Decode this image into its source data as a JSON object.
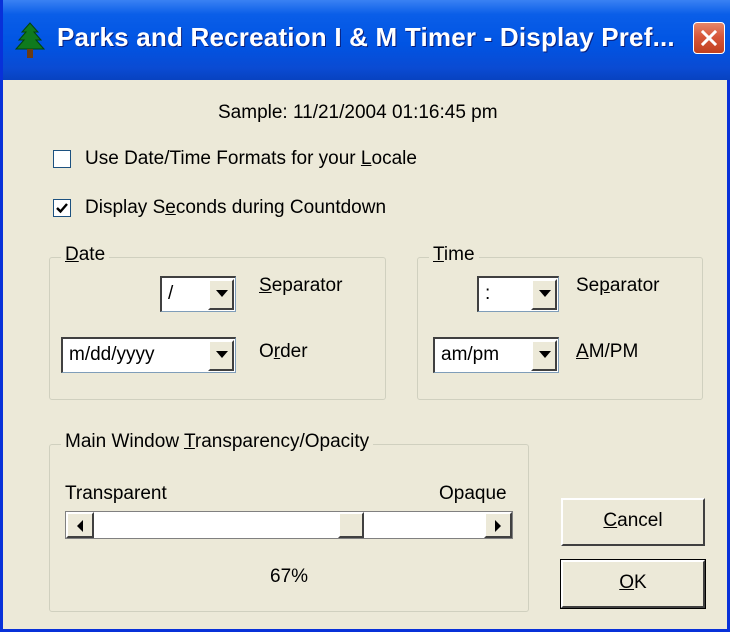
{
  "window": {
    "title": "Parks and Recreation I & M Timer - Display Pref...",
    "app_icon": "tree-icon",
    "close_icon": "close-icon"
  },
  "sample": {
    "text": "Sample: 11/21/2004 01:16:45 pm"
  },
  "options": {
    "use_locale": {
      "label_pre": "Use Date/Time Formats for your ",
      "label_key": "L",
      "label_post": "ocale",
      "checked": false
    },
    "display_seconds": {
      "label_pre": "Display S",
      "label_key": "e",
      "label_post": "conds during Countdown",
      "checked": true
    }
  },
  "date_group": {
    "label_key": "D",
    "label_post": "ate",
    "separator_value": "/",
    "separator_label_key": "S",
    "separator_label_post": "eparator",
    "order_value": "m/dd/yyyy",
    "order_label_pre": "O",
    "order_label_key": "r",
    "order_label_post": "der"
  },
  "time_group": {
    "label_key": "T",
    "label_post": "ime",
    "separator_value": ":",
    "separator_label_pre": "Se",
    "separator_label_key": "p",
    "separator_label_post": "arator",
    "ampm_value": "am/pm",
    "ampm_label_key": "A",
    "ampm_label_post": "M/PM"
  },
  "transparency": {
    "label_pre": "Main Window ",
    "label_key": "T",
    "label_post": "ransparency/Opacity",
    "min_label": "Transparent",
    "max_label": "Opaque",
    "value_percent": 67,
    "value_text": "67%"
  },
  "buttons": {
    "cancel": {
      "key": "C",
      "rest": "ancel"
    },
    "ok": {
      "key": "O",
      "rest": "K"
    }
  },
  "colors": {
    "titlebar": "#0054e3",
    "face": "#ece9d8",
    "close": "#d8573a"
  }
}
